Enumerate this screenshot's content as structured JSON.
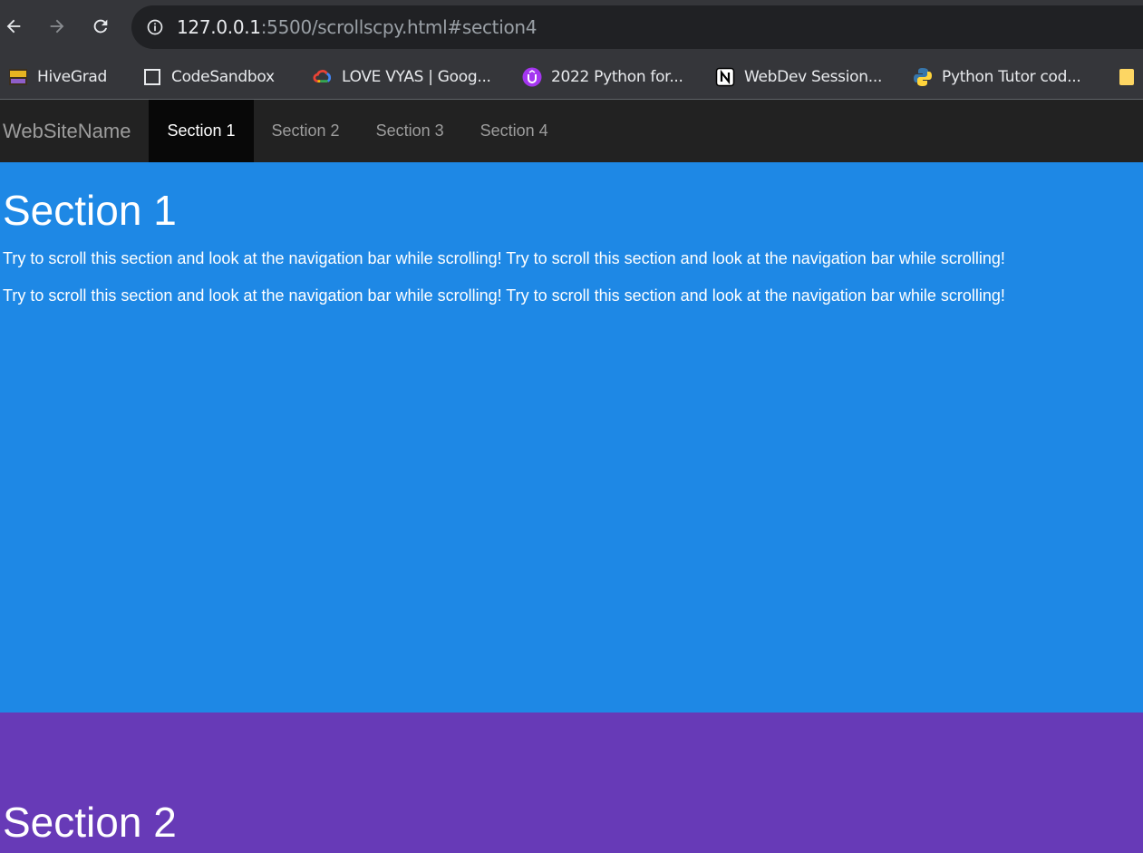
{
  "browser": {
    "url_host": "127.0.0.1",
    "url_rest": ":5500/scrollscpy.html#section4",
    "bookmarks": [
      {
        "label": "HiveGrad",
        "icon": "hive-icon"
      },
      {
        "label": "CodeSandbox",
        "icon": "codesandbox-icon"
      },
      {
        "label": "LOVE VYAS | Goog...",
        "icon": "google-cloud-icon"
      },
      {
        "label": "2022 Python for...",
        "icon": "udemy-icon"
      },
      {
        "label": "WebDev Session...",
        "icon": "notion-icon"
      },
      {
        "label": "Python Tutor cod...",
        "icon": "python-icon"
      }
    ]
  },
  "site": {
    "brand": "WebSiteName",
    "nav": [
      "Section 1",
      "Section 2",
      "Section 3",
      "Section 4"
    ],
    "active_index": 0
  },
  "section1": {
    "title": "Section 1",
    "paragraphs": [
      "Try to scroll this section and look at the navigation bar while scrolling! Try to scroll this section and look at the navigation bar while scrolling!",
      "Try to scroll this section and look at the navigation bar while scrolling! Try to scroll this section and look at the navigation bar while scrolling!"
    ],
    "color": "#1e88e5"
  },
  "section2": {
    "title": "Section 2",
    "color": "#673ab7"
  }
}
